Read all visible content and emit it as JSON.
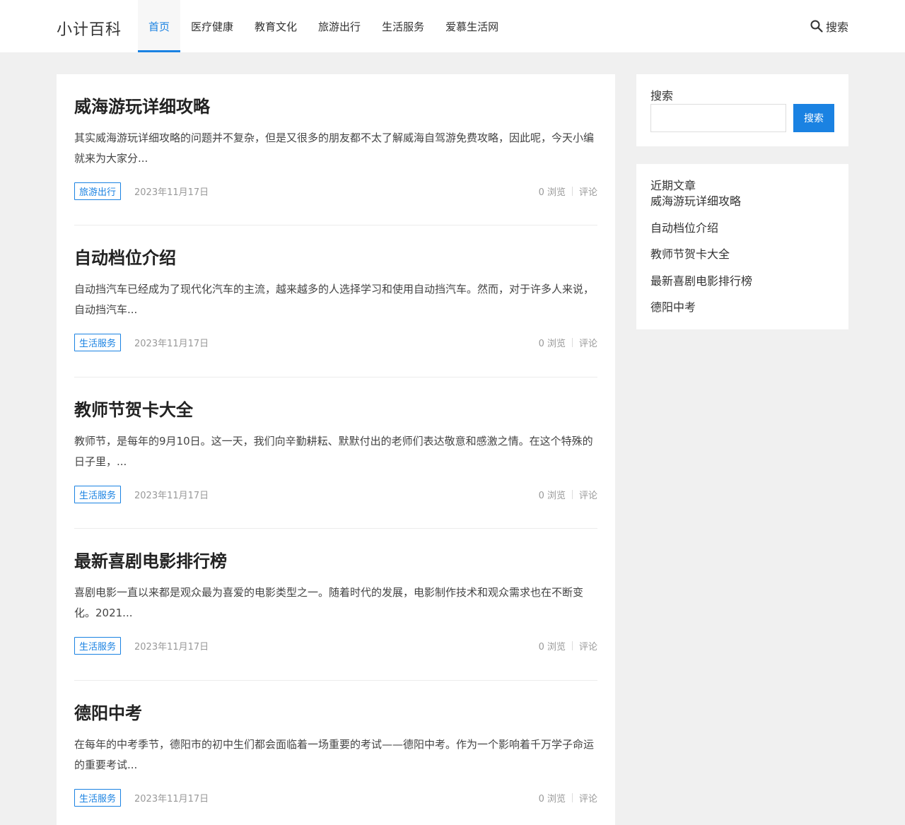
{
  "site": {
    "logo": "小计百科"
  },
  "nav": {
    "items": [
      {
        "label": "首页",
        "active": true
      },
      {
        "label": "医疗健康",
        "active": false
      },
      {
        "label": "教育文化",
        "active": false
      },
      {
        "label": "旅游出行",
        "active": false
      },
      {
        "label": "生活服务",
        "active": false
      },
      {
        "label": "爱慕生活网",
        "active": false
      }
    ],
    "search_label": "搜索"
  },
  "posts": [
    {
      "title": "威海游玩详细攻略",
      "excerpt": "其实威海游玩详细攻略的问题并不复杂，但是又很多的朋友都不太了解威海自驾游免费攻略，因此呢，今天小编就来为大家分...",
      "tag": "旅游出行",
      "date": "2023年11月17日",
      "views": "0 浏览",
      "comments": "评论"
    },
    {
      "title": "自动档位介绍",
      "excerpt": "自动挡汽车已经成为了现代化汽车的主流，越来越多的人选择学习和使用自动挡汽车。然而，对于许多人来说，自动挡汽车...",
      "tag": "生活服务",
      "date": "2023年11月17日",
      "views": "0 浏览",
      "comments": "评论"
    },
    {
      "title": "教师节贺卡大全",
      "excerpt": "教师节，是每年的9月10日。这一天，我们向辛勤耕耘、默默付出的老师们表达敬意和感激之情。在这个特殊的日子里，...",
      "tag": "生活服务",
      "date": "2023年11月17日",
      "views": "0 浏览",
      "comments": "评论"
    },
    {
      "title": "最新喜剧电影排行榜",
      "excerpt": "喜剧电影一直以来都是观众最为喜爱的电影类型之一。随着时代的发展，电影制作技术和观众需求也在不断变化。2021...",
      "tag": "生活服务",
      "date": "2023年11月17日",
      "views": "0 浏览",
      "comments": "评论"
    },
    {
      "title": "德阳中考",
      "excerpt": "在每年的中考季节，德阳市的初中生们都会面临着一场重要的考试——德阳中考。作为一个影响着千万学子命运的重要考试...",
      "tag": "生活服务",
      "date": "2023年11月17日",
      "views": "0 浏览",
      "comments": "评论"
    }
  ],
  "sidebar": {
    "search": {
      "title": "搜索",
      "placeholder": "",
      "button": "搜索"
    },
    "recent": {
      "title": "近期文章",
      "items": [
        "威海游玩详细攻略",
        "自动档位介绍",
        "教师节贺卡大全",
        "最新喜剧电影排行榜",
        "德阳中考"
      ]
    }
  },
  "colors": {
    "accent": "#1a82e2",
    "page_bg": "#f0f0f0"
  }
}
